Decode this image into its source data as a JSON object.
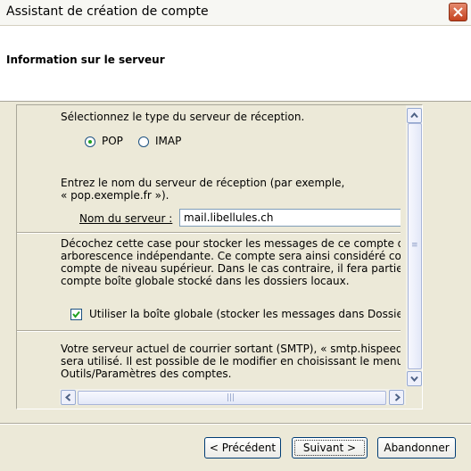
{
  "window": {
    "title": "Assistant de création de compte"
  },
  "header": {
    "title": "Information sur le serveur"
  },
  "server_type": {
    "prompt": "Sélectionnez le type du serveur de réception.",
    "options": [
      {
        "label": "POP",
        "selected": true
      },
      {
        "label": "IMAP",
        "selected": false
      }
    ]
  },
  "server_name": {
    "instruction_line1": "Entrez le nom du serveur de réception (par exemple,",
    "instruction_line2": "« pop.exemple.fr »).",
    "label": "Nom du serveur :",
    "value": "mail.libellules.ch"
  },
  "global_inbox": {
    "description_lines": [
      "Décochez cette case pour stocker les messages de ce compte dan",
      "arborescence indépendante. Ce compte sera ainsi considéré comm",
      "compte de niveau supérieur. Dans le cas contraire, il fera partie du",
      "compte boîte globale stocké dans les dossiers locaux."
    ],
    "checkbox_label": "Utiliser la boîte globale (stocker les messages dans Dossiers lo",
    "checked": true
  },
  "smtp": {
    "lines": [
      "Votre serveur actuel de courrier sortant (SMTP), « smtp.hispeed.c",
      "sera utilisé. Il est possible de le modifier en choisissant le menu",
      "Outils/Paramètres des comptes."
    ]
  },
  "buttons": {
    "previous": "< Précédent",
    "next": "Suivant >",
    "cancel": "Abandonner"
  },
  "colors": {
    "dialog_bg": "#ece9d8",
    "header_bg": "#ffffff",
    "close_button": "#c4421f",
    "radio_dot": "#21a121"
  }
}
